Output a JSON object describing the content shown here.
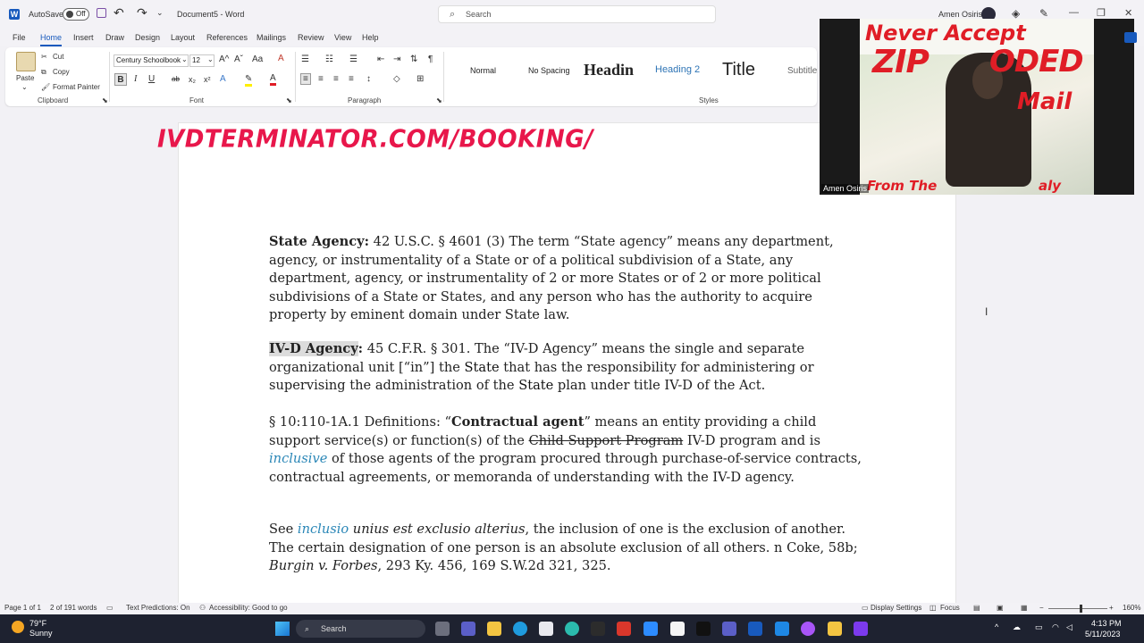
{
  "titlebar": {
    "autosave_label": "AutoSave",
    "autosave_state": "Off",
    "document_title": "Document5 - Word",
    "search_placeholder": "Search",
    "user_name": "Amen Osiris",
    "undo_label": "↶",
    "redo_label": "↷",
    "qat_more": "⌄",
    "minimize": "—",
    "restore": "❐",
    "close": "✕"
  },
  "ribbon_tabs": [
    "File",
    "Home",
    "Insert",
    "Draw",
    "Design",
    "Layout",
    "References",
    "Mailings",
    "Review",
    "View",
    "Help"
  ],
  "clipboard": {
    "paste": "Paste",
    "cut": "Cut",
    "copy": "Copy",
    "format_painter": "Format Painter",
    "label": "Clipboard"
  },
  "font": {
    "family": "Century Schoolbook",
    "size": "12",
    "label": "Font",
    "bold": "B",
    "italic": "I",
    "underline": "U",
    "strike": "ab",
    "sub": "x₂",
    "sup": "x²",
    "grow": "A^",
    "shrink": "Aˇ",
    "case": "Aa",
    "clear": "A"
  },
  "paragraph": {
    "label": "Paragraph",
    "pilcrow": "¶"
  },
  "styles": {
    "label": "Styles",
    "items": [
      "Normal",
      "No Spacing",
      "Headin",
      "Heading 2",
      "Title",
      "Subtitle"
    ]
  },
  "document": {
    "banner": "IVDTERMINATOR.COM/BOOKING/",
    "p1": {
      "term": "State Agency:",
      "text": " 42 U.S.C. § 4601 (3) The term “State agency” means any department, agency, or instrumentality of a State or of a political subdivision of a State, any department, agency, or instrumentality of 2 or more States or of 2 or more political subdivisions of a State or States, and any person who has the authority to acquire property by eminent domain under State law."
    },
    "p2": {
      "term": "IV-D Agency",
      "colon": ":",
      "t1": " 45 C.F.R. § 301. The “IV-D Agency” means the single and separate organizational unit [“in”] the ",
      "state1": "State",
      "t2": " that has the responsibility for administering or supervising the administration of the ",
      "state2": "State",
      "t3": " plan under title IV-D of the ",
      "act": "Act",
      "t4": "."
    },
    "p3": {
      "t1": "§ 10:110-1A.1 Definitions: “",
      "term": "Contractual agent",
      "t2": "” means an entity providing a child support service(s) or function(s) of the ",
      "struck": "Child Support Program",
      "t3": " IV-D program and is ",
      "inclusive": "inclusive",
      "t4": " of those agents of the program procured through purchase-of-service contracts, contractual agreements, or memoranda of understanding with the IV-D agency."
    },
    "p4": {
      "t1": "See ",
      "link": "inclusio",
      "t2": " unius est exclusio alterius",
      "t3": ", the inclusion of one is the exclusion of another. The certain designation of one person is an absolute exclusion of all others. n Coke, 58b; ",
      "case": "Burgin v. Forbes",
      "t4": ", 293 Ky. 456, 169 S.W.2d 321, 325."
    }
  },
  "video": {
    "line1": "Never Accept",
    "line2": "ZIP",
    "line3": "ODED",
    "line4": "Mail",
    "line5": "From The",
    "line5b": "aly",
    "participant": "Amen Osiris"
  },
  "statusbar": {
    "page": "Page 1 of 1",
    "words": "2 of 191 words",
    "text_predictions": "Text Predictions: On",
    "accessibility": "Accessibility: Good to go",
    "display_settings": "Display Settings",
    "focus": "Focus",
    "zoom": "160%"
  },
  "taskbar": {
    "weather_temp": "79°F",
    "weather_desc": "Sunny",
    "search": "Search",
    "time": "4:13 PM",
    "date": "5/11/2023"
  }
}
